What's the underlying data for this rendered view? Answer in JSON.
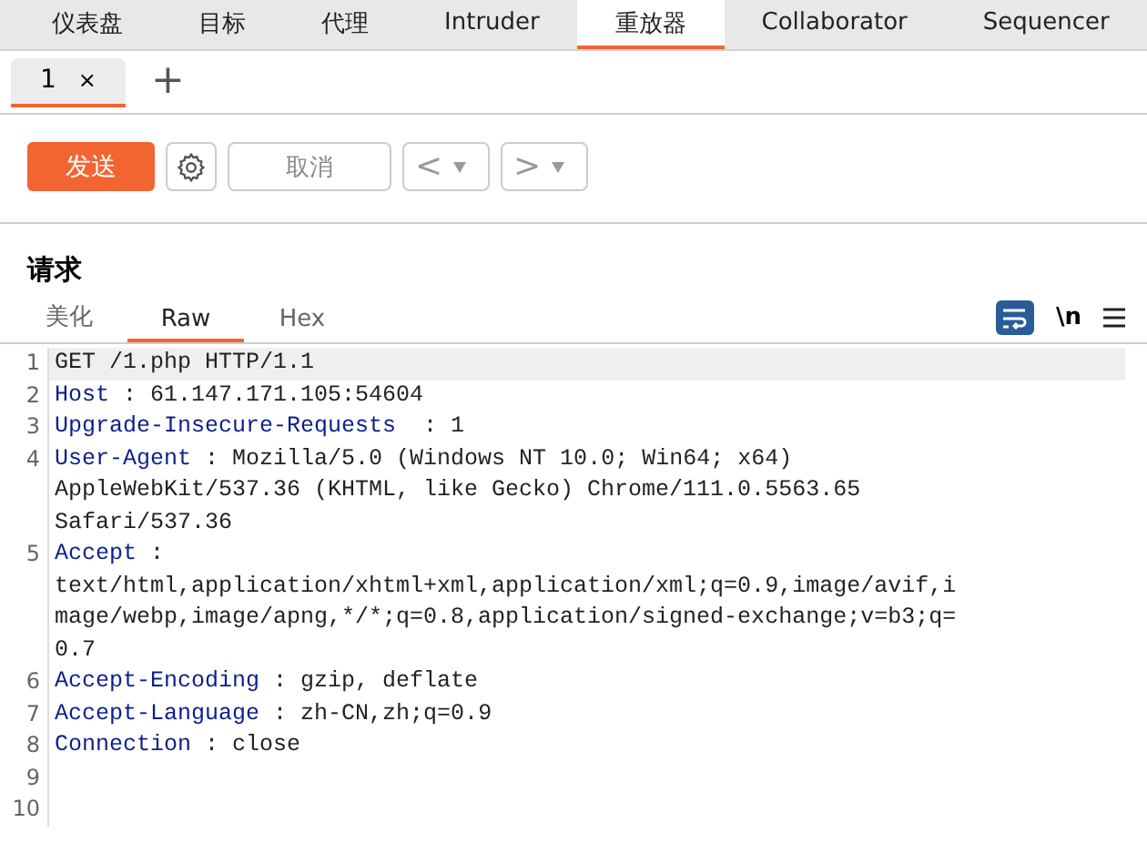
{
  "main_tabs": [
    {
      "label": "仪表盘",
      "selected": false
    },
    {
      "label": "目标",
      "selected": false
    },
    {
      "label": "代理",
      "selected": false
    },
    {
      "label": "Intruder",
      "selected": false
    },
    {
      "label": "重放器",
      "selected": true
    },
    {
      "label": "Collaborator",
      "selected": false
    },
    {
      "label": "Sequencer",
      "selected": false
    }
  ],
  "request_tabs": [
    {
      "label": "1",
      "close": "×",
      "selected": true
    }
  ],
  "add_tab": "+",
  "toolbar": {
    "send": "发送",
    "cancel": "取消",
    "cancel_disabled": true,
    "back": "<",
    "forward": ">"
  },
  "request": {
    "title": "请求",
    "view_tabs": [
      {
        "label": "美化",
        "selected": false
      },
      {
        "label": "Raw",
        "selected": true
      },
      {
        "label": "Hex",
        "selected": false
      }
    ],
    "wrap_on": true,
    "newline_toggle": "\\n",
    "lines": [
      {
        "number": "1",
        "kind": "plain",
        "current": true,
        "value": "GET /1.php HTTP/1.1"
      },
      {
        "number": "2",
        "kind": "header",
        "current": false,
        "name": "Host",
        "separator": " : ",
        "value": "61.147.171.105:54604"
      },
      {
        "number": "3",
        "kind": "header",
        "current": false,
        "name": "Upgrade-Insecure-Requests",
        "separator": "  : ",
        "value": "1"
      },
      {
        "number": "4",
        "kind": "header",
        "current": false,
        "name": "User-Agent",
        "separator": " : ",
        "value": "Mozilla/5.0 (Windows NT 10.0; Win64; x64)",
        "wrapped": [
          "AppleWebKit/537.36 (KHTML, like Gecko) Chrome/111.0.5563.65",
          "Safari/537.36"
        ]
      },
      {
        "number": "5",
        "kind": "header",
        "current": false,
        "name": "Accept",
        "separator": " :",
        "wrapped": [
          "text/html,application/xhtml+xml,application/xml;q=0.9,image/avif,i",
          "mage/webp,image/apng,*/*;q=0.8,application/signed-exchange;v=b3;q=",
          "0.7"
        ]
      },
      {
        "number": "6",
        "kind": "header",
        "current": false,
        "name": "Accept-Encoding",
        "separator": " : ",
        "value": "gzip, deflate"
      },
      {
        "number": "7",
        "kind": "header",
        "current": false,
        "name": "Accept-Language",
        "separator": " : ",
        "value": "zh-CN,zh;q=0.9"
      },
      {
        "number": "8",
        "kind": "header",
        "current": false,
        "name": "Connection",
        "separator": " : ",
        "value": "close"
      },
      {
        "number": "9",
        "kind": "plain",
        "current": false
      },
      {
        "number": "10",
        "kind": "plain",
        "current": false
      }
    ]
  }
}
